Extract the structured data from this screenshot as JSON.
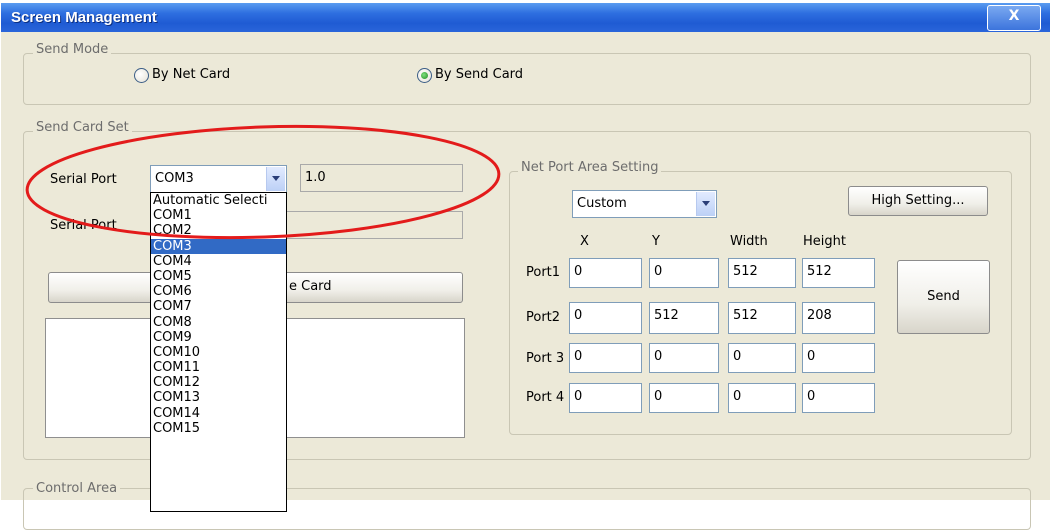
{
  "window": {
    "title": "Screen Management",
    "close_label": "X"
  },
  "send_mode": {
    "label": "Send Mode",
    "options": [
      "By Net Card",
      "By Send Card"
    ],
    "selected": "By Send Card"
  },
  "send_card_set": {
    "label": "Send Card Set",
    "serial_port_label_1": "Serial Port",
    "serial_port_value": "COM3",
    "serial_port_version": "1.0",
    "serial_port_label_2": "Serial Port",
    "card_button_label": "e Card"
  },
  "serial_dropdown": {
    "items": [
      "Automatic Selecti",
      "COM1",
      "COM2",
      "COM3",
      "COM4",
      "COM5",
      "COM6",
      "COM7",
      "COM8",
      "COM9",
      "COM10",
      "COM11",
      "COM12",
      "COM13",
      "COM14",
      "COM15"
    ],
    "selected_index": 3
  },
  "net_port_area": {
    "label": "Net Port Area Setting",
    "mode": "Custom",
    "high_setting_label": "High Setting...",
    "columns": [
      "X",
      "Y",
      "Width",
      "Height"
    ],
    "ports": [
      {
        "name": "Port1",
        "x": "0",
        "y": "0",
        "width": "512",
        "height": "512"
      },
      {
        "name": "Port2",
        "x": "0",
        "y": "512",
        "width": "512",
        "height": "208"
      },
      {
        "name": "Port 3",
        "x": "0",
        "y": "0",
        "width": "0",
        "height": "0"
      },
      {
        "name": "Port 4",
        "x": "0",
        "y": "0",
        "width": "0",
        "height": "0"
      }
    ],
    "send_label": "Send"
  },
  "control_area": {
    "label": "Control Area"
  },
  "colors": {
    "title_bar": "#2e6fe0",
    "window_bg": "#ece9d8",
    "selection": "#316ac5",
    "annotation": "#e31b1b"
  }
}
